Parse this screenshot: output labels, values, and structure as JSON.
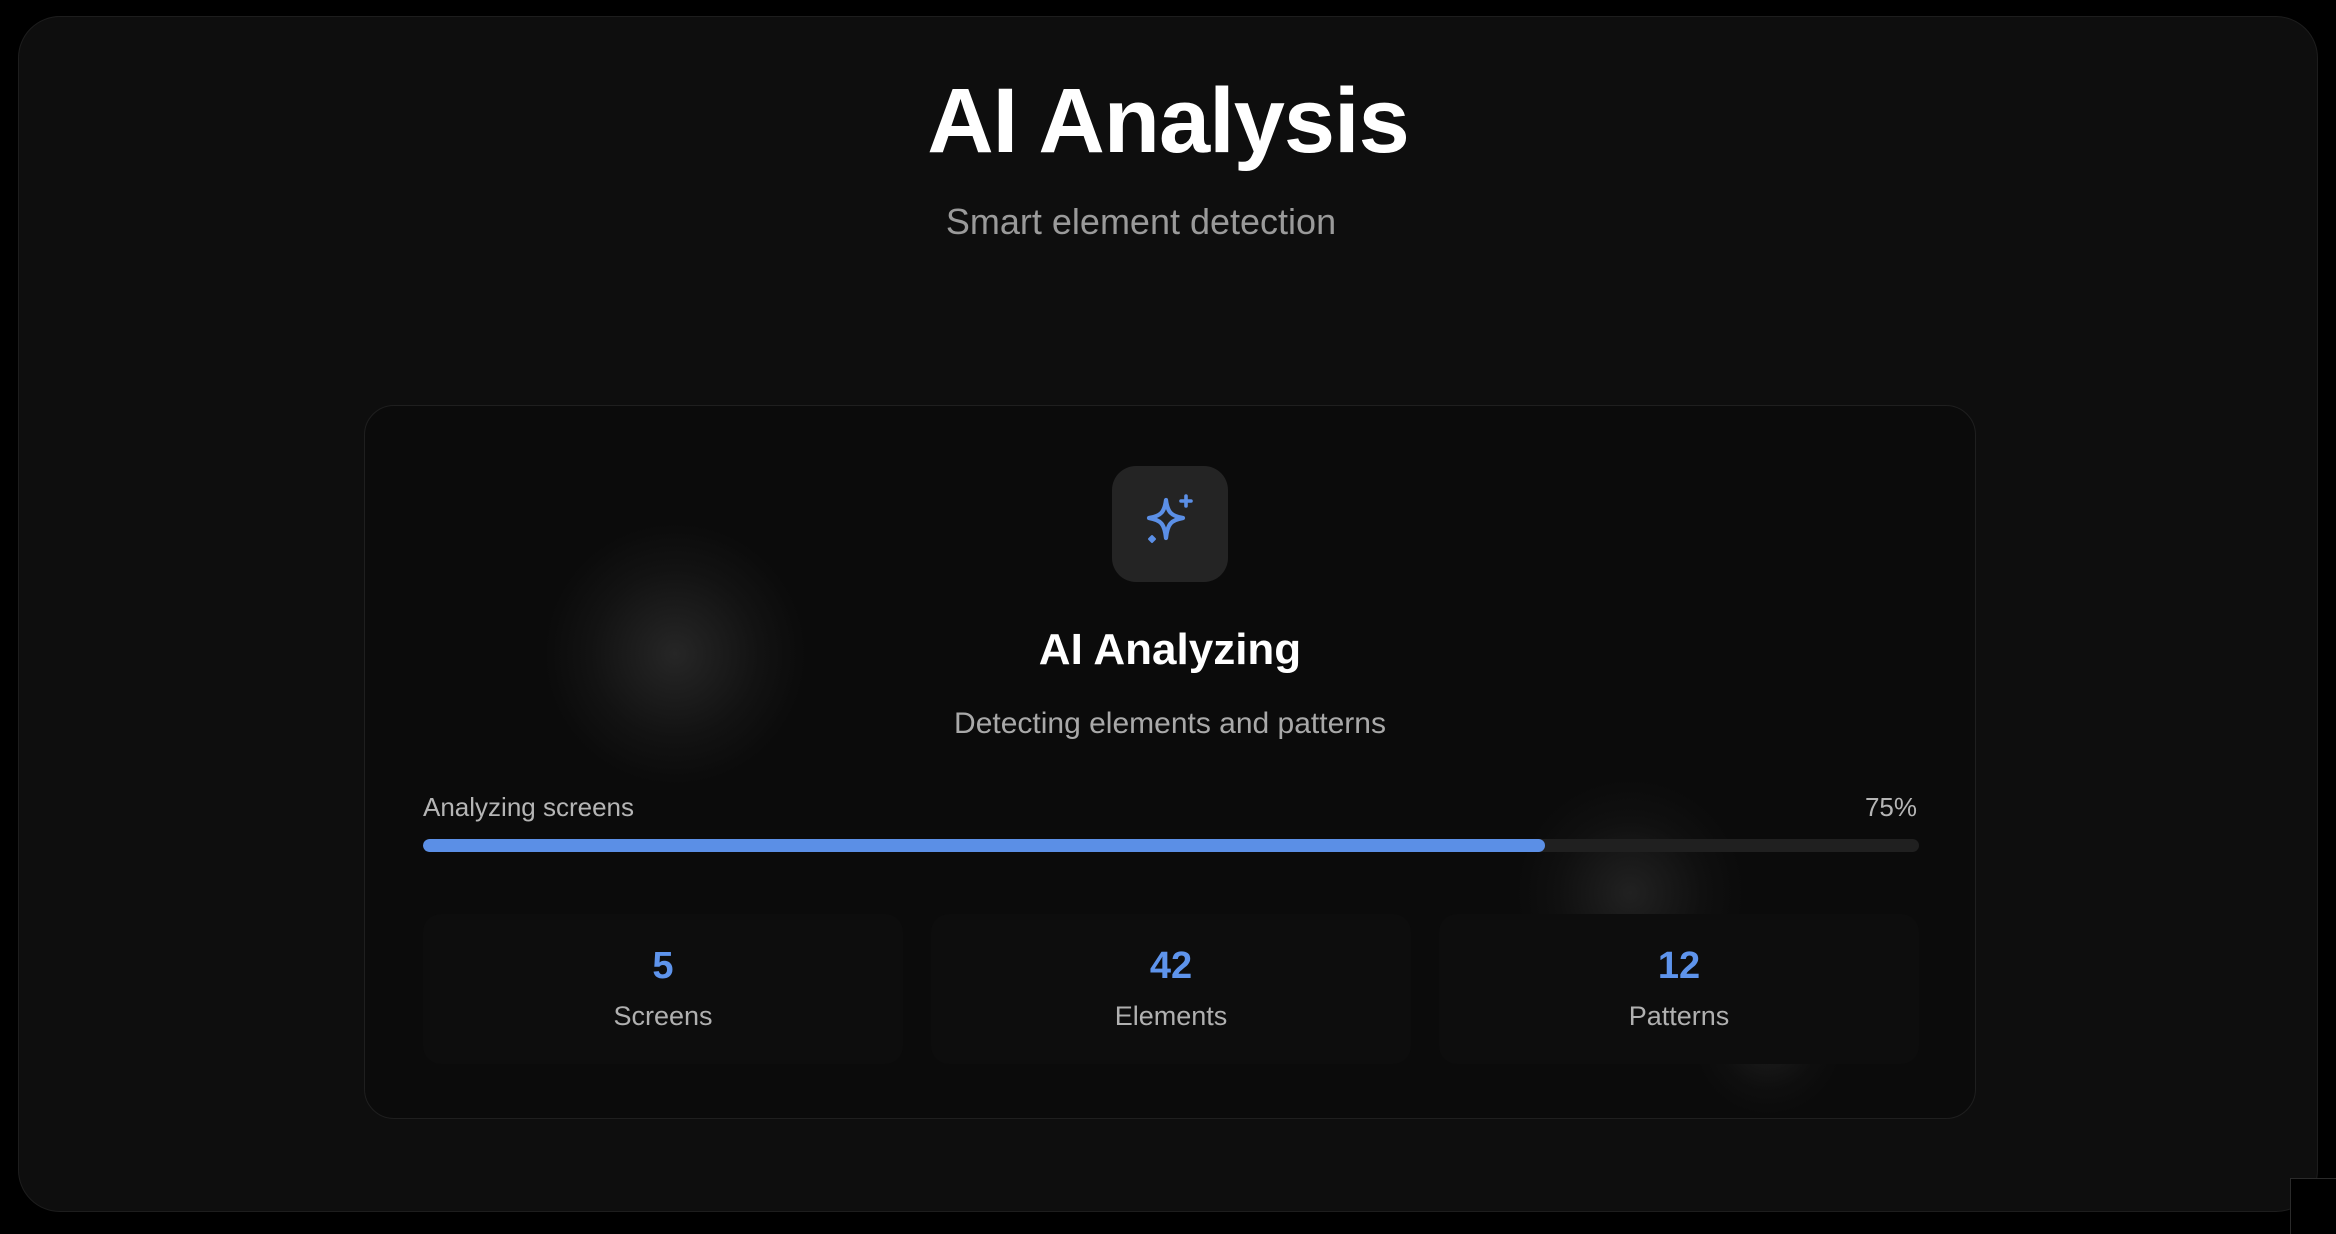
{
  "header": {
    "title": "AI Analysis",
    "subtitle": "Smart element detection"
  },
  "card": {
    "icon": "sparkles-icon",
    "title": "AI Analyzing",
    "subtitle": "Detecting elements and patterns",
    "progress": {
      "label": "Analyzing screens",
      "percent_text": "75%",
      "fraction": 0.75
    },
    "stats": [
      {
        "value": "5",
        "label": "Screens"
      },
      {
        "value": "42",
        "label": "Elements"
      },
      {
        "value": "12",
        "label": "Patterns"
      }
    ]
  },
  "colors": {
    "accent": "#5b8fe6",
    "background": "#0e0e0e",
    "card": "#0b0b0b"
  }
}
